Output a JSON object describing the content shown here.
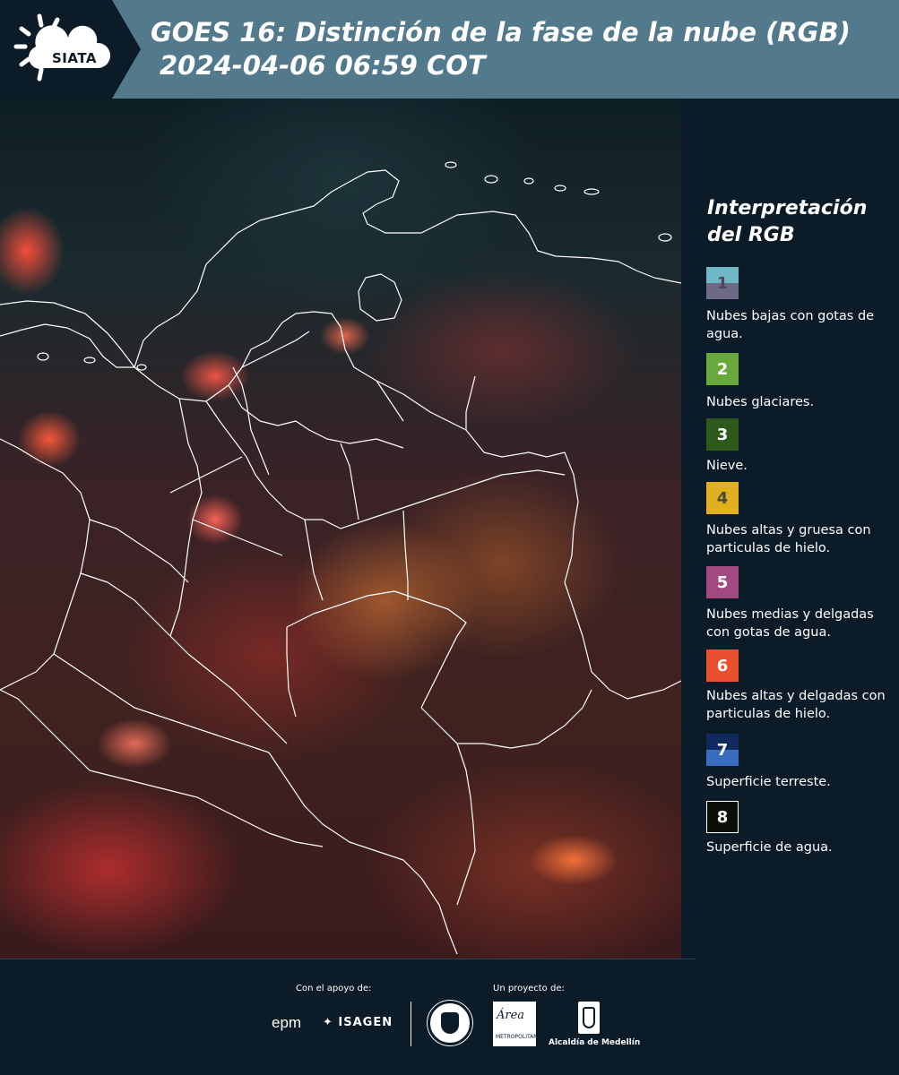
{
  "header": {
    "logo_text": "SIATA",
    "title": "GOES 16: Distinción de la fase de la nube (RGB)",
    "datetime": "2024-04-06 06:59 COT"
  },
  "legend": {
    "title": "Interpretación del RGB",
    "items": [
      {
        "number": "1",
        "label": "Nubes bajas con gotas de agua.",
        "color_top": "#6fb8c6",
        "color_bottom": "#6d6a86",
        "text_color": "#4a4a5a"
      },
      {
        "number": "2",
        "label": "Nubes glaciares.",
        "color_top": "#69a83a",
        "color_bottom": "#69a83a",
        "text_color": "#ffffff"
      },
      {
        "number": "3",
        "label": "Nieve.",
        "color_top": "#2d5a1c",
        "color_bottom": "#2d5a1c",
        "text_color": "#ffffff"
      },
      {
        "number": "4",
        "label": "Nubes altas y gruesa con particulas de hielo.",
        "color_top": "#e0b020",
        "color_bottom": "#e0b020",
        "text_color": "#4a4a3a"
      },
      {
        "number": "5",
        "label": "Nubes medias y delgadas con gotas de agua.",
        "color_top": "#a24a80",
        "color_bottom": "#a24a80",
        "text_color": "#ffffff"
      },
      {
        "number": "6",
        "label": "Nubes altas y delgadas con particulas de hielo.",
        "color_top": "#e8502e",
        "color_bottom": "#e8502e",
        "text_color": "#ffffff"
      },
      {
        "number": "7",
        "label": "Superficie terreste.",
        "color_top": "#102a60",
        "color_bottom": "#3a6cc0",
        "text_color": "#ffffff"
      },
      {
        "number": "8",
        "label": "Superficie de agua.",
        "color_top": "#0a0f08",
        "color_bottom": "#0a0f08",
        "text_color": "#ffffff",
        "border": "#ffffff"
      }
    ]
  },
  "footer": {
    "support_label": "Con el apoyo de:",
    "project_label": "Un proyecto de:",
    "epm": "epm",
    "isagen": "ISAGEN",
    "area_name": "Área",
    "area_sub": "METROPOLITANA",
    "medellin": "Alcaldía de Medellín"
  },
  "colors": {
    "background": "#0b1c28",
    "header_band": "#527a8c",
    "borders": "#ffffff"
  }
}
